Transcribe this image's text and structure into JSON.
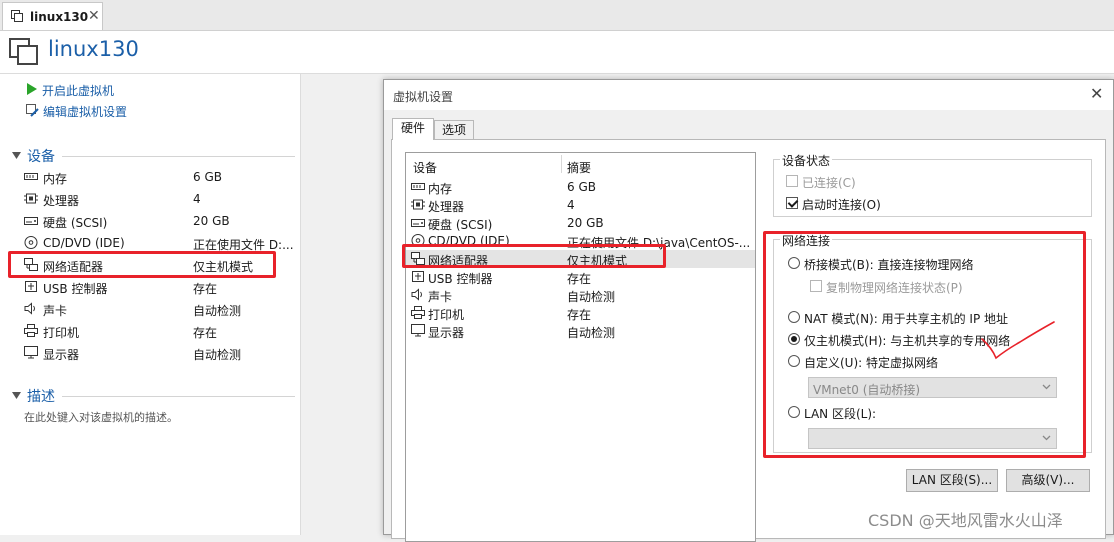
{
  "tab": {
    "label": "linux130",
    "close": "✕"
  },
  "title": "linux130",
  "actions": {
    "power_on": "开启此虚拟机",
    "edit_settings": "编辑虚拟机设置"
  },
  "devices_section": {
    "label": "设备",
    "items": [
      {
        "name": "内存",
        "value": "6 GB",
        "icon": "memory-icon"
      },
      {
        "name": "处理器",
        "value": "4",
        "icon": "cpu-icon"
      },
      {
        "name": "硬盘 (SCSI)",
        "value": "20 GB",
        "icon": "harddisk-icon"
      },
      {
        "name": "CD/DVD (IDE)",
        "value": "正在使用文件 D:...",
        "icon": "cdrom-icon"
      },
      {
        "name": "网络适配器",
        "value": "仅主机模式",
        "icon": "network-icon"
      },
      {
        "name": "USB 控制器",
        "value": "存在",
        "icon": "usb-icon"
      },
      {
        "name": "声卡",
        "value": "自动检测",
        "icon": "sound-icon"
      },
      {
        "name": "打印机",
        "value": "存在",
        "icon": "printer-icon"
      },
      {
        "name": "显示器",
        "value": "自动检测",
        "icon": "display-icon"
      }
    ]
  },
  "description_section": {
    "label": "描述",
    "placeholder": "在此处键入对该虚拟机的描述。"
  },
  "dialog": {
    "title": "虚拟机设置",
    "close": "✕",
    "tabs": [
      "硬件",
      "选项"
    ],
    "list_headers": {
      "device": "设备",
      "summary": "摘要"
    },
    "devices": [
      {
        "name": "内存",
        "value": "6 GB"
      },
      {
        "name": "处理器",
        "value": "4"
      },
      {
        "name": "硬盘 (SCSI)",
        "value": "20 GB"
      },
      {
        "name": "CD/DVD (IDE)",
        "value": "正在使用文件 D:\\java\\CentOS-..."
      },
      {
        "name": "网络适配器",
        "value": "仅主机模式"
      },
      {
        "name": "USB 控制器",
        "value": "存在"
      },
      {
        "name": "声卡",
        "value": "自动检测"
      },
      {
        "name": "打印机",
        "value": "存在"
      },
      {
        "name": "显示器",
        "value": "自动检测"
      }
    ],
    "device_status": {
      "legend": "设备状态",
      "connected": "已连接(C)",
      "connect_at_power_on": "启动时连接(O)"
    },
    "network_connection": {
      "legend": "网络连接",
      "bridged": "桥接模式(B): 直接连接物理网络",
      "replicate": "复制物理网络连接状态(P)",
      "nat": "NAT 模式(N): 用于共享主机的 IP 地址",
      "host_only": "仅主机模式(H): 与主机共享的专用网络",
      "custom": "自定义(U): 特定虚拟网络",
      "custom_value": "VMnet0 (自动桥接)",
      "lan": "LAN 区段(L):",
      "lan_value": ""
    },
    "buttons": {
      "lan_segments": "LAN 区段(S)...",
      "advanced": "高级(V)..."
    }
  },
  "watermark": "CSDN @天地风雷水火山泽",
  "colors": {
    "accent": "#1b5fa8",
    "highlight": "#e8222a"
  }
}
